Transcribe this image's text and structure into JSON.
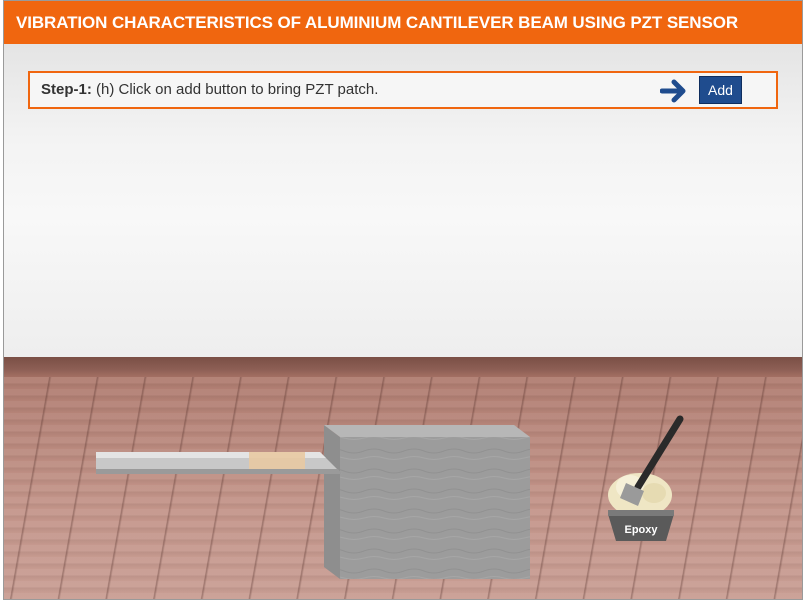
{
  "header": {
    "title": "VIBRATION CHARACTERISTICS OF ALUMINIUM CANTILEVER BEAM USING PZT SENSOR"
  },
  "step": {
    "label": "Step-1:",
    "instruction": " (h) Click on add button to bring PZT patch.",
    "add_button": "Add",
    "arrow_icon": "arrow-right-icon"
  },
  "scene": {
    "epoxy_label": "Epoxy"
  },
  "colors": {
    "header_bg": "#f0660f",
    "step_border": "#f0660f",
    "add_button_bg": "#1f4c8e",
    "arrow": "#1f4c8e"
  }
}
